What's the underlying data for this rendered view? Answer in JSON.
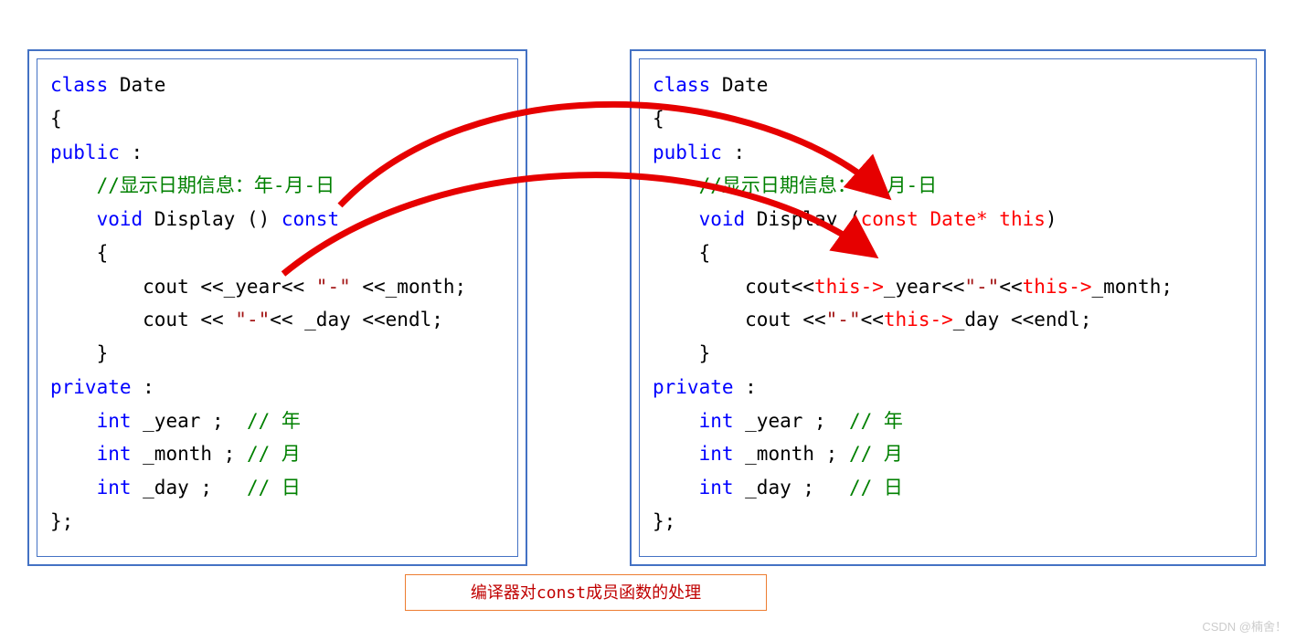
{
  "caption": "编译器对const成员函数的处理",
  "watermark": "CSDN @楠舍！",
  "left": {
    "l1_kw": "class",
    "l1_id": " Date",
    "l2": "{",
    "l3_kw": "public",
    "l3_rest": " :",
    "l4_cm": "    //显示日期信息：年-月-日",
    "l5_kw1": "    void",
    "l5_mid": " Display () ",
    "l5_kw2": "const",
    "l6": "    {",
    "l7a": "        cout <<_year<< ",
    "l7s": "\"-\"",
    "l7b": " <<_month;",
    "l8a": "        cout << ",
    "l8s": "\"-\"",
    "l8b": "<< _day <<endl;",
    "l9": "    }",
    "l10_kw": "private",
    "l10_rest": " :",
    "l11a": "    int",
    "l11b": " _year ;  ",
    "l11c": "// 年",
    "l12a": "    int",
    "l12b": " _month ; ",
    "l12c": "// 月",
    "l13a": "    int",
    "l13b": " _day ;   ",
    "l13c": "// 日",
    "l14": "};"
  },
  "right": {
    "l1_kw": "class",
    "l1_id": " Date",
    "l2": "{",
    "l3_kw": "public",
    "l3_rest": " :",
    "l4_cm": "    //显示日期信息：年-月-日",
    "l5_kw1": "    void",
    "l5_mid1": " Display (",
    "l5_hl": "const Date* this",
    "l5_mid2": ")",
    "l6": "    {",
    "l7a": "        cout<<",
    "l7h1": "this->",
    "l7b": "_year<<",
    "l7s": "\"-\"",
    "l7c": "<<",
    "l7h2": "this->",
    "l7d": "_month;",
    "l8a": "        cout <<",
    "l8s": "\"-\"",
    "l8b": "<<",
    "l8h": "this->",
    "l8c": "_day <<endl;",
    "l9": "    }",
    "l10_kw": "private",
    "l10_rest": " :",
    "l11a": "    int",
    "l11b": " _year ;  ",
    "l11c": "// 年",
    "l12a": "    int",
    "l12b": " _month ; ",
    "l12c": "// 月",
    "l13a": "    int",
    "l13b": " _day ;   ",
    "l13c": "// 日",
    "l14": "};"
  }
}
